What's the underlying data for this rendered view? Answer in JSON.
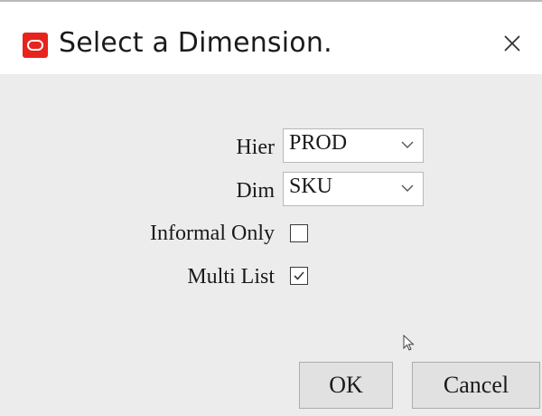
{
  "window": {
    "title": "Select a Dimension.",
    "app_icon": "oracle-logo-icon",
    "close_icon": "close-icon"
  },
  "form": {
    "hier": {
      "label": "Hier",
      "value": "PROD"
    },
    "dim": {
      "label": "Dim",
      "value": "SKU"
    },
    "informal_only": {
      "label": "Informal Only",
      "checked": false
    },
    "multi_list": {
      "label": "Multi List",
      "checked": true
    }
  },
  "buttons": {
    "ok": "OK",
    "cancel": "Cancel"
  },
  "colors": {
    "client_bg": "#ececec",
    "brand_red": "#e8231e"
  }
}
